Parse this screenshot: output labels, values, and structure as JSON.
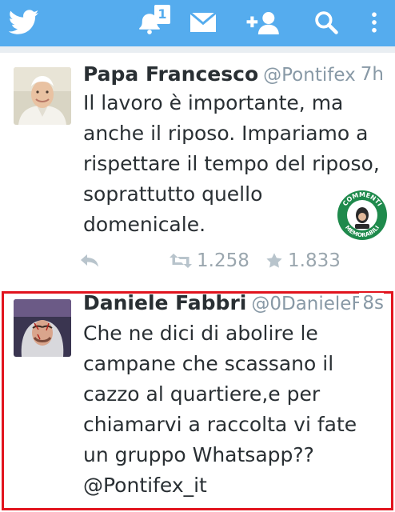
{
  "topbar": {
    "bg": "#55acee",
    "notification_count": "1",
    "icons": [
      "twitter-bird-icon",
      "notifications-bell-icon",
      "messages-envelope-icon",
      "add-user-icon",
      "search-icon",
      "more-options-icon"
    ]
  },
  "tweets": [
    {
      "name": "Papa Francesco",
      "handle": "@Pontifex…",
      "time": "7h",
      "lines": [
        "Il lavoro è importante, ma",
        "anche il riposo. Impariamo a",
        "rispettare il tempo del riposo,",
        "soprattutto quello",
        "domenicale."
      ],
      "retweets": "1.258",
      "favorites": "1.833",
      "stamp_text_top": "COMMENTI",
      "stamp_text_bottom": "MEMORABILI"
    },
    {
      "name": "Daniele Fabbri",
      "handle": "@0DanieleF…",
      "time": "8s",
      "lines": [
        "Che ne dici di abolire le",
        "campane che scassano il",
        "cazzo al quartiere,e per",
        "chiamarvi a raccolta vi fate",
        "un gruppo Whatsapp??",
        "@Pontifex_it"
      ],
      "highlight_color": "#e1141e"
    }
  ]
}
